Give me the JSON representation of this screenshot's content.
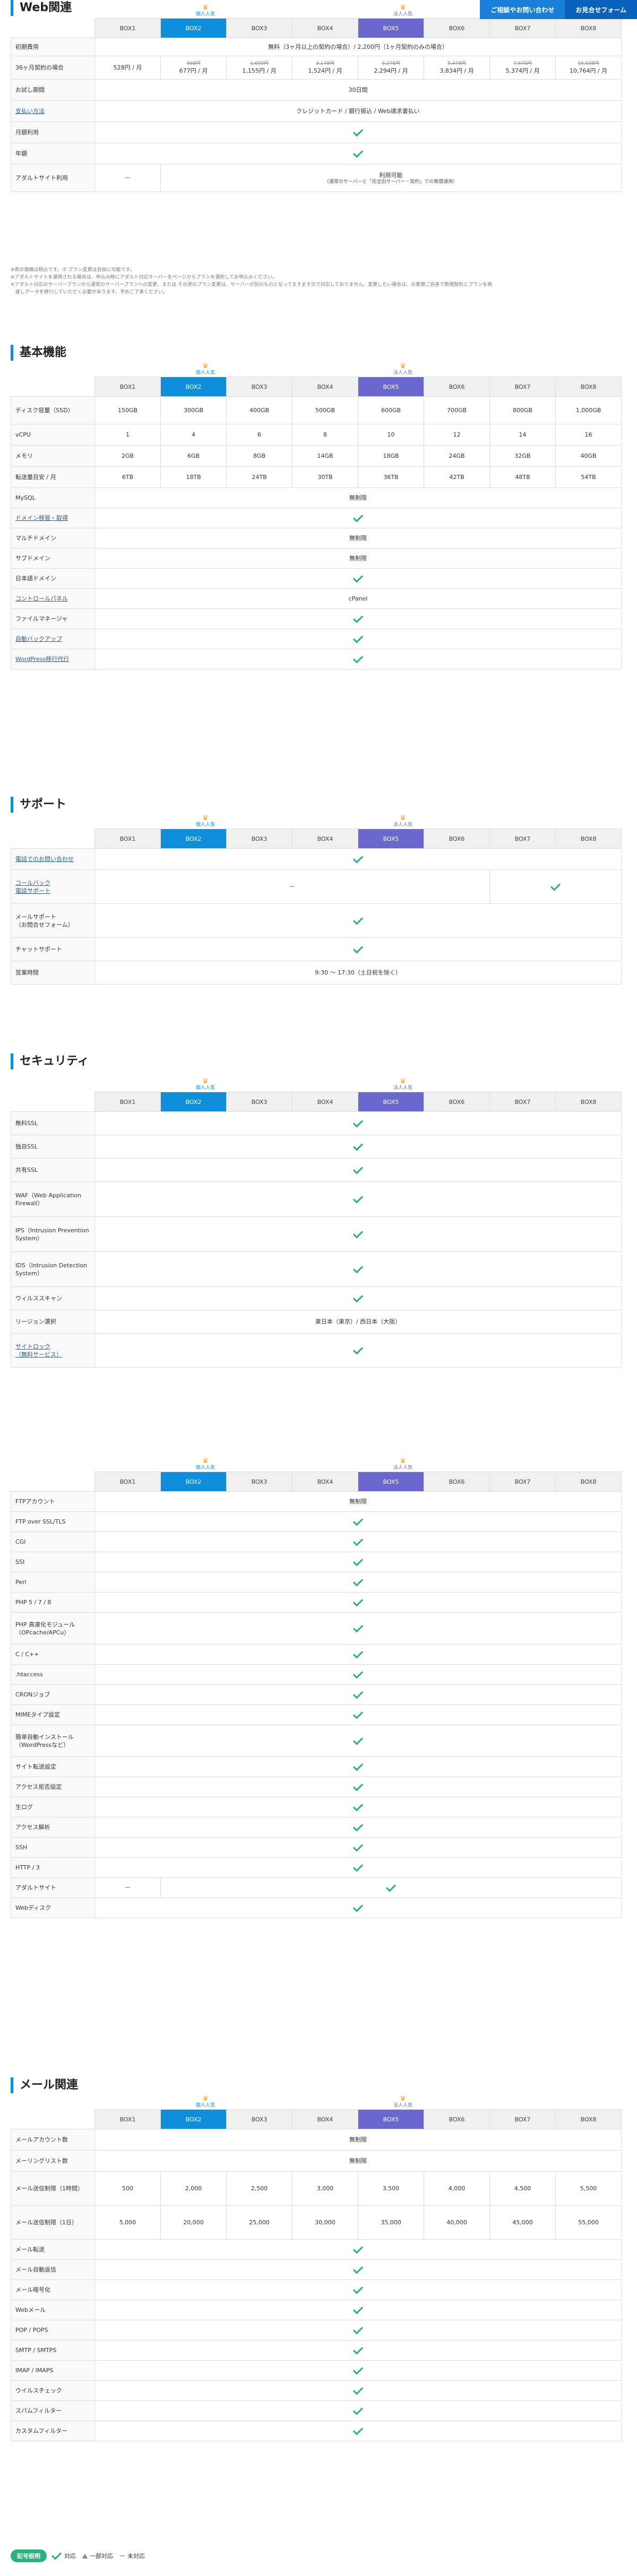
{
  "topbar": {
    "inquiry": "ご相談やお問い合わせ",
    "form": "お見合せフォーム"
  },
  "headers": [
    "BOX1",
    "BOX2",
    "BOX3",
    "BOX4",
    "BOX5",
    "BOX6",
    "BOX7",
    "BOX8"
  ],
  "badges": {
    "popular": "個人人気",
    "corporate": "法人人気"
  },
  "sections": {
    "basic": "基本機能",
    "support": "サポート",
    "security": "セキュリティ",
    "web": "Web関連",
    "mail": "メール関連"
  },
  "common": {
    "check": "✓",
    "dash": "ー",
    "unlimited": "無制限"
  },
  "price": {
    "initial_label": "初期費用",
    "initial_value": "無料（3ヶ月以上の契約の場合）/ 2,200円（1ヶ月契約のみの場合）",
    "row36_label": "36ヶ月契約の場合",
    "row36_box1": "528円 / 月",
    "row36_old": [
      "",
      "968円",
      "1,650円",
      "2,178円",
      "3,278円",
      "5,478円",
      "7,678円",
      "16,038円"
    ],
    "row36_new": [
      "",
      "677円 / 月",
      "1,155円 / 月",
      "1,524円 / 月",
      "2,294円 / 月",
      "3,834円 / 月",
      "5,374円 / 月",
      "10,764円 / 月"
    ],
    "trial_label": "お試し期間",
    "trial_value": "30日間",
    "payment_label": "支払い方法",
    "payment_value": "クレジットカード / 銀行振込 / Web請求書払い",
    "monthly_label": "月額利用",
    "annual_label": "年額",
    "adult_label": "アダルトサイト利用",
    "adult_value": "利用可能",
    "adult_sub": "（通常のサーバーと「完全別サーバー・契約」での無償運用）"
  },
  "notes": [
    "※表示価格は税込です。ホ プラン変更は自由に可能です。",
    "※アダルトサイトを運用される場合は、申込み時にアダルト対応サーバーをページからプランを選択してお申込みください。",
    "※アダルト対応のサーバープランから通常のサーバープランへの変更、または その逆のプラン変更は、サーバーが別のものとなってますますので対応しておりません。変更したい場合は、お客様ご自身で新規契約とプランを再",
    "　度しデータを移行していただく必要があります。予めご了承ください。"
  ],
  "basic": {
    "disk_label": "ディスク容量（SSD）",
    "disk": [
      "150GB",
      "300GB",
      "400GB",
      "500GB",
      "600GB",
      "700GB",
      "800GB",
      "1,000GB"
    ],
    "vcpu_label": "vCPU",
    "vcpu": [
      "1",
      "4",
      "6",
      "8",
      "10",
      "12",
      "14",
      "16"
    ],
    "mem_label": "メモリ",
    "mem": [
      "2GB",
      "6GB",
      "8GB",
      "14GB",
      "18GB",
      "24GB",
      "32GB",
      "40GB"
    ],
    "traffic_label": "転送量目安 / 月",
    "traffic": [
      "6TB",
      "18TB",
      "24TB",
      "30TB",
      "36TB",
      "42TB",
      "48TB",
      "54TB"
    ],
    "mysql_label": "MySQL",
    "domain_label": "ドメイン移管・取得",
    "multi_label": "マルチドメイン",
    "sub_label": "サブドメイン",
    "jp_label": "日本語ドメイン",
    "panel_label": "コントロールパネル",
    "panel_value": "cPanel",
    "fm_label": "ファイルマネージャ",
    "backup_label": "自動バックアップ",
    "wp_label": "WordPress移行代行"
  },
  "support": {
    "phone_label": "電話でのお問い合わせ",
    "callback_label1": "コールバック",
    "callback_label2": "電話サポート",
    "mail_label1": "メールサポート",
    "mail_label2": "（お問合せフォーム）",
    "chat_label": "チャットサポート",
    "hours_label": "営業時間",
    "hours_value": "9:30 〜 17:30（土日祝を除く）"
  },
  "security": {
    "free_ssl": "無料SSL",
    "paid_ssl": "独自SSL",
    "shared_ssl": "共有SSL",
    "waf": "WAF（Web Application Firewall）",
    "ips": "IPS（Intrusion Prevention System）",
    "ids": "IDS（Intrusion Detection System）",
    "virus": "ウィルススキャン",
    "region": "リージョン選択",
    "region_value": "東日本（東京）/ 西日本（大阪）",
    "sitelock1": "サイトロック",
    "sitelock2": "（無料サービス）"
  },
  "web": {
    "ftp": "FTPアカウント",
    "ftps": "FTP over SSL/TLS",
    "cgi": "CGI",
    "ssi": "SSI",
    "perl": "Perl",
    "php": "PHP 5 / 7 / 8",
    "phpmod": "PHP 高速化モジュール（OPcache/APCu）",
    "c": "C / C++",
    "htaccess": ".htaccess",
    "cron": "CRONジョブ",
    "mime": "MIMEタイプ設定",
    "autoinstall": "簡単自動インストール（WordPressなど）",
    "redirect": "サイト転送設定",
    "access_limit": "アクセス拒否設定",
    "log": "生ログ",
    "analytics": "アクセス解析",
    "ssh": "SSH",
    "http3": "HTTP / 3",
    "adult": "アダルトサイト",
    "webdisk": "Webディスク"
  },
  "mail": {
    "accounts": "メールアカウント数",
    "ml": "メーリングリスト数",
    "limit_hour": "メール送信制限（1時間）",
    "limit_hour_values": [
      "500",
      "2,000",
      "2,500",
      "3,000",
      "3,500",
      "4,000",
      "4,500",
      "5,500"
    ],
    "limit_day": "メール送信制限（1日）",
    "limit_day_values": [
      "5,000",
      "20,000",
      "25,000",
      "30,000",
      "35,000",
      "40,000",
      "45,000",
      "55,000"
    ],
    "forward": "メール転送",
    "autoreply": "メール自動返信",
    "encrypt": "メール暗号化",
    "webmail": "Webメール",
    "pop": "POP / POPS",
    "smtp": "SMTP / SMTPS",
    "imap": "IMAP / IMAPS",
    "virus": "ウイルスチェック",
    "spam": "スパムフィルター",
    "custom": "カスタムフィルター"
  },
  "legend": {
    "title": "記号説明",
    "check": "対応",
    "partial": "一部対応",
    "none": "未対応"
  },
  "colors": {
    "box2": "#0e8edb",
    "box5": "#6a67ce",
    "check": "#2ab27b",
    "accent": "#0e8edb"
  }
}
